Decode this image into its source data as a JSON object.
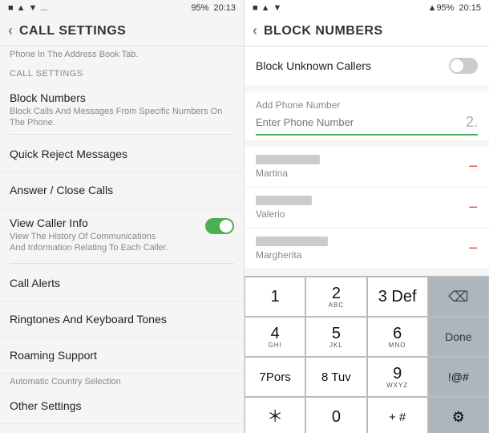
{
  "left": {
    "status_bar": {
      "icons": "■ ▲ ▼ ...",
      "battery": "95%",
      "time": "20:13"
    },
    "header": {
      "back_label": "‹",
      "title": "CALL SETTINGS"
    },
    "subtitle": "Phone In The Address Book Tab.",
    "section_label": "CALL SETTINGS",
    "menu_items": [
      {
        "title": "Block Numbers",
        "subtitle": "Block Calls And Messages From Specific Numbers On The Phone."
      },
      {
        "title": "Quick Reject Messages",
        "subtitle": ""
      },
      {
        "title": "Answer / Close Calls",
        "subtitle": ""
      }
    ],
    "toggle_item": {
      "title": "View Caller Info",
      "subtitle": "View The History Of Communications And Information Relating To Each Caller."
    },
    "bottom_items": [
      {
        "title": "Call Alerts"
      },
      {
        "title": "Ringtones And Keyboard Tones"
      },
      {
        "title": "Roaming Support"
      },
      {
        "title": "Automatic Country Selection"
      },
      {
        "title": "Other Settings"
      }
    ]
  },
  "right": {
    "status_bar": {
      "icons": "■ ▲ ▼",
      "signal": "▲95%",
      "time": "20:15"
    },
    "header": {
      "back_label": "‹",
      "title": "BLOCK NUMBERS"
    },
    "block_unknown": {
      "label": "Block Unknown Callers",
      "toggle_state": "off"
    },
    "add_phone": {
      "label": "Add Phone Number",
      "placeholder": "Enter Phone Number",
      "suffix": "2."
    },
    "blocked_contacts": [
      {
        "name": "Martina"
      },
      {
        "name": "Valerio"
      },
      {
        "name": "Margherita"
      }
    ],
    "numpad": {
      "rows": [
        [
          {
            "main": "1",
            "sub": ""
          },
          {
            "main": "2",
            "sub": "ABC"
          },
          {
            "main": "3 Def",
            "sub": ""
          },
          {
            "main": "⌫",
            "sub": "",
            "type": "backspace"
          }
        ],
        [
          {
            "main": "4",
            "sub": "GHI"
          },
          {
            "main": "5",
            "sub": "JKL"
          },
          {
            "main": "6",
            "sub": "MNO"
          },
          {
            "main": "Done",
            "sub": "",
            "type": "done"
          }
        ],
        [
          {
            "main": "7Pors",
            "sub": ""
          },
          {
            "main": "8 Tuv",
            "sub": ""
          },
          {
            "main": "9",
            "sub": "WXYZ"
          },
          {
            "main": "!@#",
            "sub": "",
            "type": "special"
          }
        ],
        [
          {
            "main": "＊",
            "sub": ""
          },
          {
            "main": "0",
            "sub": ""
          },
          {
            "main": "+  #",
            "sub": ""
          },
          {
            "main": "⚙",
            "sub": "",
            "type": "settings"
          }
        ]
      ]
    }
  }
}
